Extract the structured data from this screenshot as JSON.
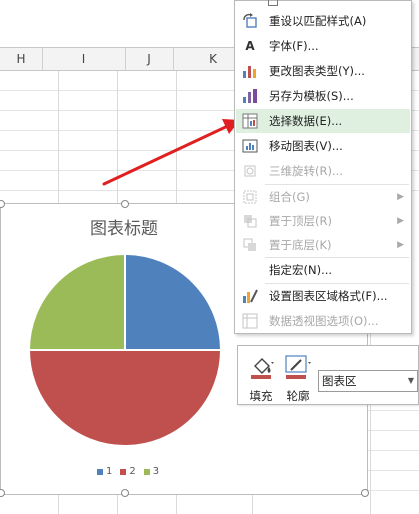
{
  "sheet": {
    "columns": [
      "H",
      "I",
      "J",
      "K"
    ]
  },
  "chart": {
    "title": "图表标题",
    "legend": [
      {
        "label": "1",
        "color": "#4f81bd"
      },
      {
        "label": "2",
        "color": "#c0504d"
      },
      {
        "label": "3",
        "color": "#9bbb59"
      }
    ]
  },
  "chart_data": {
    "type": "pie",
    "title": "图表标题",
    "categories": [
      "1",
      "2",
      "3"
    ],
    "values": [
      25,
      50,
      25
    ],
    "colors": [
      "#4f81bd",
      "#c0504d",
      "#9bbb59"
    ],
    "legend_position": "bottom"
  },
  "context_menu": {
    "items": [
      {
        "label": "重设以匹配样式(A)",
        "icon": "reset-style-icon",
        "enabled": true,
        "submenu": false
      },
      {
        "label": "字体(F)...",
        "icon": "font-icon",
        "enabled": true,
        "submenu": false
      },
      {
        "label": "更改图表类型(Y)...",
        "icon": "chart-type-icon",
        "enabled": true,
        "submenu": false
      },
      {
        "label": "另存为模板(S)...",
        "icon": "save-template-icon",
        "enabled": true,
        "submenu": false
      },
      {
        "label": "选择数据(E)...",
        "icon": "select-data-icon",
        "enabled": true,
        "submenu": false,
        "highlighted": true
      },
      {
        "label": "移动图表(V)...",
        "icon": "move-chart-icon",
        "enabled": true,
        "submenu": false
      },
      {
        "label": "三维旋转(R)...",
        "icon": "rotate-3d-icon",
        "enabled": false,
        "submenu": false
      },
      {
        "label": "组合(G)",
        "icon": "group-icon",
        "enabled": false,
        "submenu": true
      },
      {
        "label": "置于顶层(R)",
        "icon": "bring-front-icon",
        "enabled": false,
        "submenu": true
      },
      {
        "label": "置于底层(K)",
        "icon": "send-back-icon",
        "enabled": false,
        "submenu": true
      },
      {
        "label": "指定宏(N)...",
        "icon": "",
        "enabled": true,
        "submenu": false
      },
      {
        "label": "设置图表区域格式(F)...",
        "icon": "format-chart-area-icon",
        "enabled": true,
        "submenu": false
      },
      {
        "label": "数据透视图选项(O)...",
        "icon": "pivot-chart-options-icon",
        "enabled": false,
        "submenu": false
      }
    ]
  },
  "mini_toolbar": {
    "fill_label": "填充",
    "outline_label": "轮廓",
    "element_value": "图表区",
    "fill_color": "#c0504d",
    "outline_color": "#c0504d"
  },
  "accent": {
    "highlight": "#dff0e0",
    "arrow": "#e02020"
  }
}
